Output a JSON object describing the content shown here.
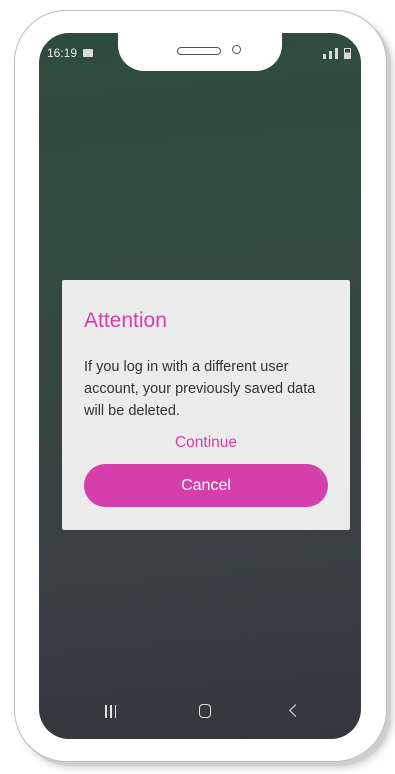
{
  "status_bar": {
    "time": "16:19",
    "icons": [
      "gallery-icon",
      "wifi-icon",
      "signal-icon",
      "signal-icon",
      "battery-icon"
    ]
  },
  "dialog": {
    "title": "Attention",
    "message": "If you log in with a different user account, your previously saved data will be deleted.",
    "continue_label": "Continue",
    "cancel_label": "Cancel"
  },
  "navbar": {
    "icons": [
      "recents-icon",
      "home-icon",
      "back-icon"
    ]
  },
  "colors": {
    "accent": "#d63fa6",
    "button": "#d53fac",
    "dialog_bg": "#ebebeb",
    "screen_top": "#2e4c3d",
    "screen_bottom": "#35373d"
  }
}
